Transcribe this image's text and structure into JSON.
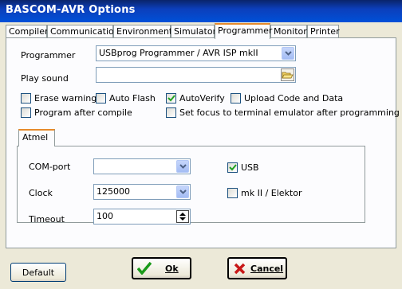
{
  "window": {
    "title": "BASCOM-AVR Options"
  },
  "tabs": [
    {
      "label": "Compiler"
    },
    {
      "label": "Communication"
    },
    {
      "label": "Environment"
    },
    {
      "label": "Simulator"
    },
    {
      "label": "Programmer",
      "active": true
    },
    {
      "label": "Monitor"
    },
    {
      "label": "Printer"
    }
  ],
  "programmer": {
    "programmer_label": "Programmer",
    "programmer_value": "USBprog Programmer / AVR ISP mkII",
    "play_sound_label": "Play sound",
    "play_sound_value": ""
  },
  "options": {
    "erase_warning": {
      "label": "Erase warning",
      "checked": false
    },
    "auto_flash": {
      "label": "Auto Flash",
      "checked": false
    },
    "auto_verify": {
      "label": "AutoVerify",
      "checked": true
    },
    "upload_code": {
      "label": "Upload Code and Data",
      "checked": false
    },
    "program_after_compile": {
      "label": "Program after compile",
      "checked": false
    },
    "set_focus": {
      "label": "Set focus to terminal emulator after programming",
      "checked": false
    }
  },
  "atmel": {
    "tab_label": "Atmel",
    "com_port_label": "COM-port",
    "com_port_value": "",
    "clock_label": "Clock",
    "clock_value": "125000",
    "timeout_label": "Timeout",
    "timeout_value": "100",
    "usb": {
      "label": "USB",
      "checked": true
    },
    "mkii": {
      "label": "mk II / Elektor",
      "checked": false
    }
  },
  "buttons": {
    "default_label": "Default",
    "ok_label": "Ok",
    "cancel_label": "Cancel"
  },
  "colors": {
    "title_bar": "#0050d8",
    "ok_icon": "#1a9a1a",
    "cancel_icon": "#c81818",
    "tab_highlight": "#e68b2c"
  }
}
